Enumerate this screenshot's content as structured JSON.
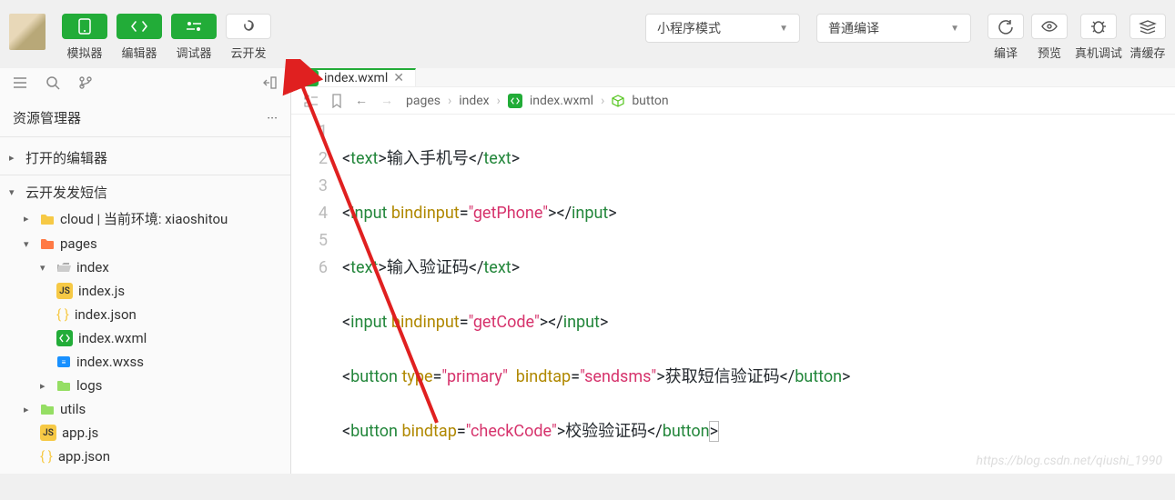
{
  "toolbar": {
    "simulator_label": "模拟器",
    "editor_label": "编辑器",
    "debugger_label": "调试器",
    "cloud_label": "云开发",
    "mode_dropdown": "小程序模式",
    "compile_dropdown": "普通编译",
    "compile_label": "编译",
    "preview_label": "预览",
    "realdevice_label": "真机调试",
    "clearcache_label": "清缓存"
  },
  "explorer": {
    "title": "资源管理器",
    "open_editors": "打开的编辑器",
    "project": "云开发发短信",
    "cloud_env": "cloud | 当前环境: xiaoshitou",
    "pages": "pages",
    "index_dir": "index",
    "index_js": "index.js",
    "index_json": "index.json",
    "index_wxml": "index.wxml",
    "index_wxss": "index.wxss",
    "logs": "logs",
    "utils": "utils",
    "app_js": "app.js",
    "app_json": "app.json"
  },
  "tab": {
    "label": "index.wxml"
  },
  "breadcrumb": {
    "p1": "pages",
    "p2": "index",
    "p3": "index.wxml",
    "p4": "button"
  },
  "code": {
    "lines": [
      "1",
      "2",
      "3",
      "4",
      "5",
      "6"
    ],
    "l1_text": "输入手机号",
    "l2_attr": "getPhone",
    "l3_text": "输入验证码",
    "l4_attr": "getCode",
    "l5_type": "primary",
    "l5_bindtap": "sendsms",
    "l5_text": "获取短信验证码",
    "l6_bindtap": "checkCode",
    "l6_text": "校验验证码"
  },
  "watermark": "https://blog.csdn.net/qiushi_1990"
}
